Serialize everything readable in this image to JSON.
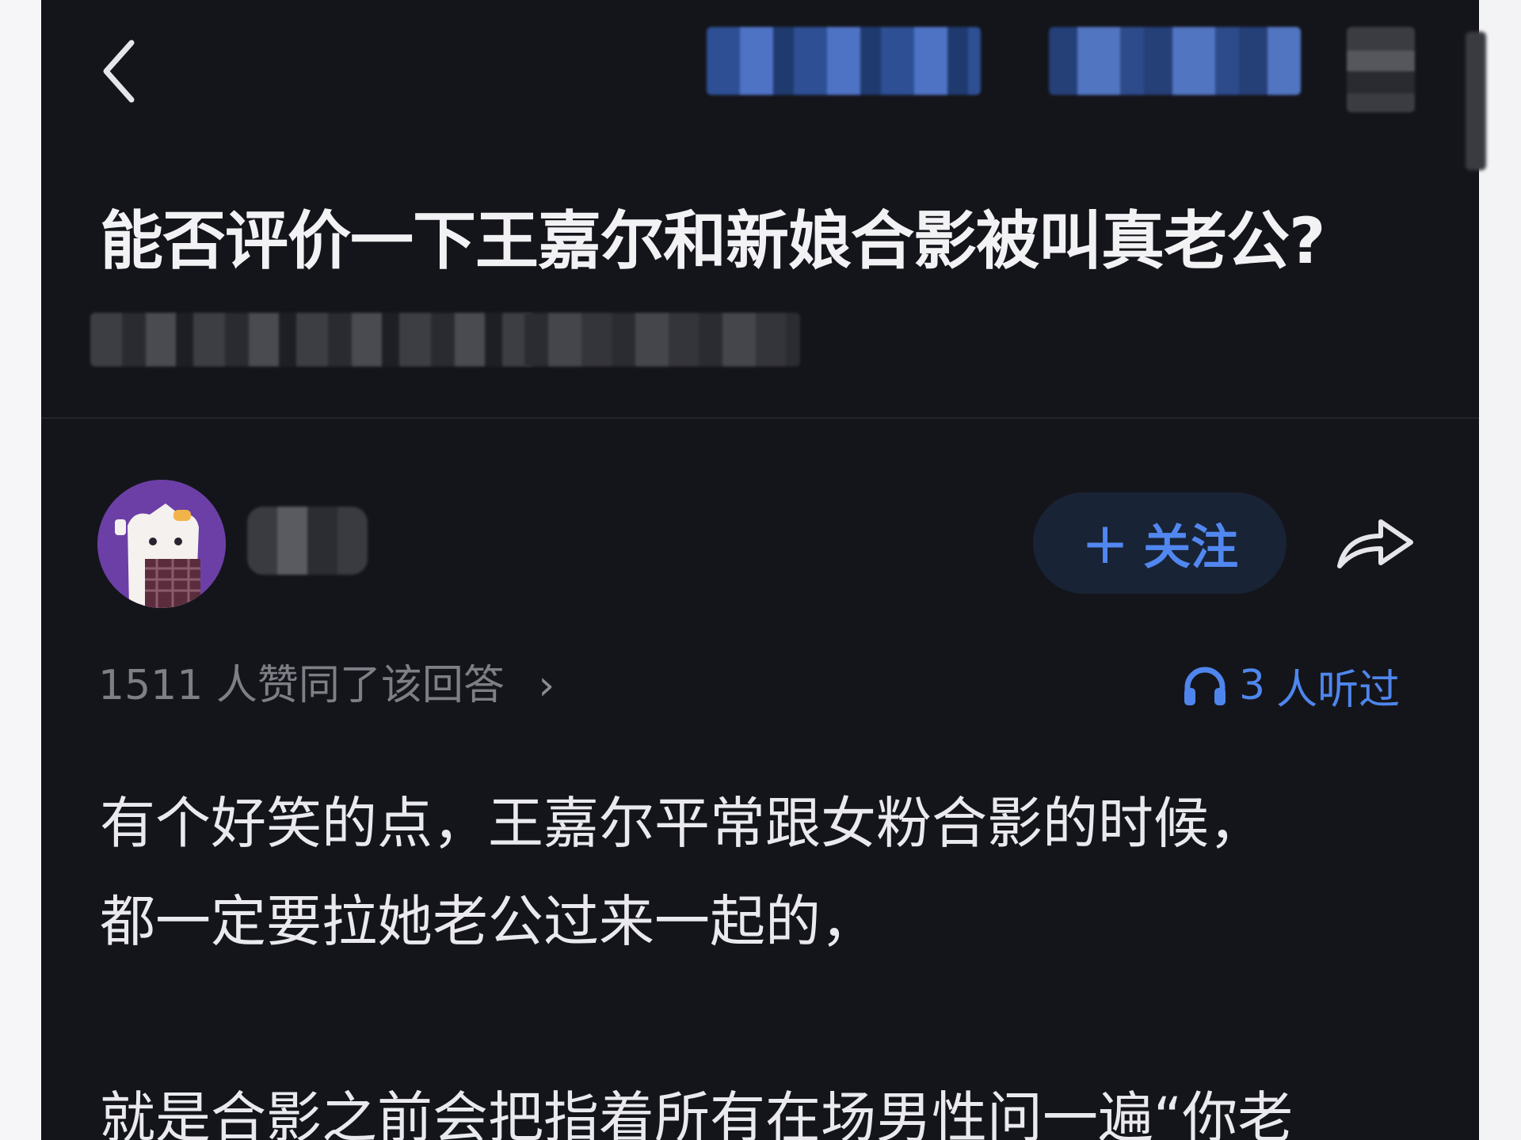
{
  "nav": {
    "back_icon": "chevron-left-icon",
    "tabs_redacted": 2,
    "more_redacted": true
  },
  "question": {
    "title": "能否评价一下王嘉尔和新娘合影被叫真老公?"
  },
  "answer": {
    "follow_label": "关注",
    "follow_icon": "plus-icon",
    "share_icon": "share-arrow-icon",
    "upvote_count": "1511",
    "upvote_text": "人赞同了该回答",
    "listen_count": "3",
    "listen_text": "人听过",
    "listen_icon": "headphones-icon",
    "paragraphs": [
      "有个好笑的点，王嘉尔平常跟女粉合影的时候，",
      "都一定要拉她老公过来一起的，",
      "就是合影之前会把指着所有在场男性问一遍“你老"
    ]
  },
  "colors": {
    "background": "#14151a",
    "accent": "#4f86ee",
    "follow_bg": "#182335",
    "text_primary": "#f2f2f5",
    "text_secondary": "#7d7e86"
  }
}
